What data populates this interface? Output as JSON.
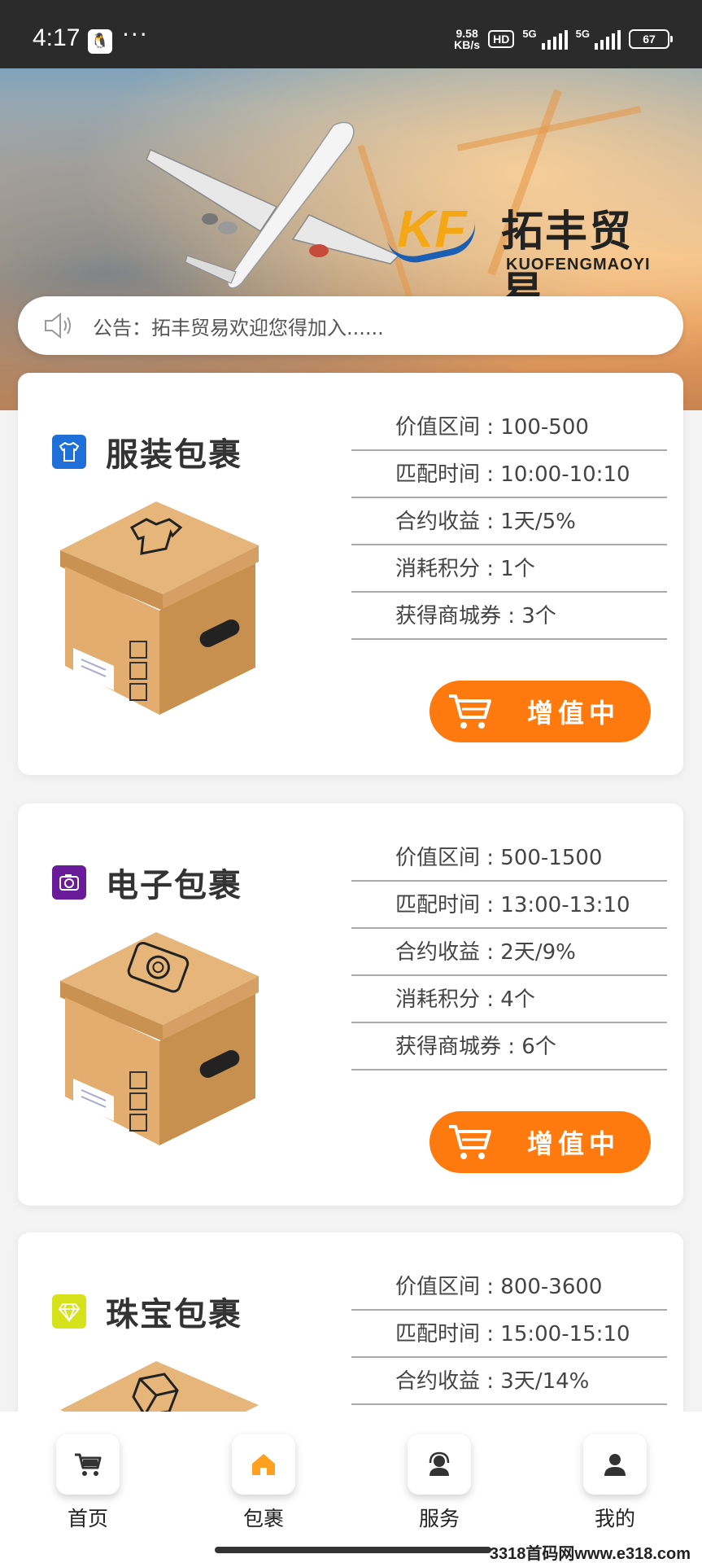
{
  "status_bar": {
    "time": "4:17",
    "speed_top": "9.58",
    "speed_bottom": "KB/s",
    "hd": "HD",
    "net1": "5G",
    "net2": "5G",
    "battery": "67"
  },
  "banner": {
    "logo_letters": "KF",
    "brand_cn": "拓丰贸易",
    "brand_en": "KUOFENGMAOYI"
  },
  "notice": {
    "text": "公告：拓丰贸易欢迎您得加入......"
  },
  "packages": [
    {
      "name": "服装包裹",
      "icon": "tshirt-icon",
      "icon_color": "#1e6fd8",
      "rows": [
        "价值区间 : 100-500",
        "匹配时间 : 10:00-10:10",
        "合约收益 : 1天/5%",
        "消耗积分 : 1个",
        "获得商城券 : 3个"
      ],
      "button": "增值中"
    },
    {
      "name": "电子包裹",
      "icon": "camera-icon",
      "icon_color": "#6a1b9a",
      "rows": [
        "价值区间 : 500-1500",
        "匹配时间 : 13:00-13:10",
        "合约收益 : 2天/9%",
        "消耗积分 : 4个",
        "获得商城券 : 6个"
      ],
      "button": "增值中"
    },
    {
      "name": "珠宝包裹",
      "icon": "diamond-icon",
      "icon_color": "#d6e21b",
      "rows": [
        "价值区间 : 800-3600",
        "匹配时间 : 15:00-15:10",
        "合约收益 : 3天/14%"
      ]
    }
  ],
  "tabs": [
    {
      "label": "首页",
      "icon": "cart-icon"
    },
    {
      "label": "包裹",
      "icon": "home-icon"
    },
    {
      "label": "服务",
      "icon": "service-icon"
    },
    {
      "label": "我的",
      "icon": "user-icon"
    }
  ],
  "colors": {
    "accent": "#ff7a0e",
    "brand_blue": "#1a5fb4",
    "brand_gold": "#f5a815"
  },
  "watermark": "3318首码网www.e318.com"
}
